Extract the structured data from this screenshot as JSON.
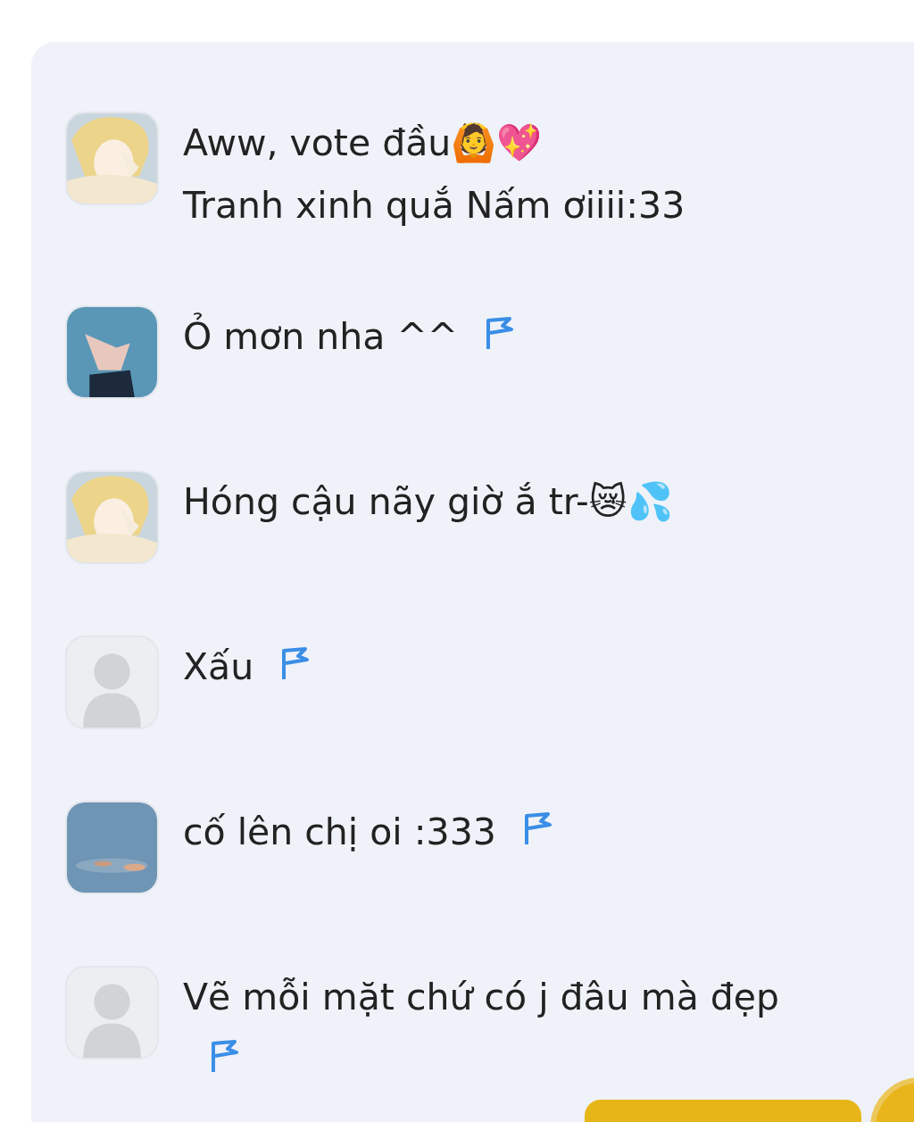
{
  "comments": [
    {
      "avatar": {
        "kind": "picture"
      },
      "lines": [
        "Aww, vote đầu🙆💖",
        "Tranh xinh quắ Nấm ơiiii:33"
      ],
      "flag": false
    },
    {
      "avatar": {
        "kind": "picture"
      },
      "lines": [
        "Ỏ mơn nha ^^"
      ],
      "flag": true
    },
    {
      "avatar": {
        "kind": "picture"
      },
      "lines": [
        "Hóng cậu nãy giờ ắ tr-😿💦"
      ],
      "flag": false
    },
    {
      "avatar": {
        "kind": "default"
      },
      "lines": [
        "Xấu"
      ],
      "flag": true
    },
    {
      "avatar": {
        "kind": "picture"
      },
      "lines": [
        "cố lên chị oi :333"
      ],
      "flag": true
    },
    {
      "avatar": {
        "kind": "default"
      },
      "lines": [
        "Vẽ mỗi mặt chứ có j đâu mà đẹp"
      ],
      "flag": true
    }
  ]
}
